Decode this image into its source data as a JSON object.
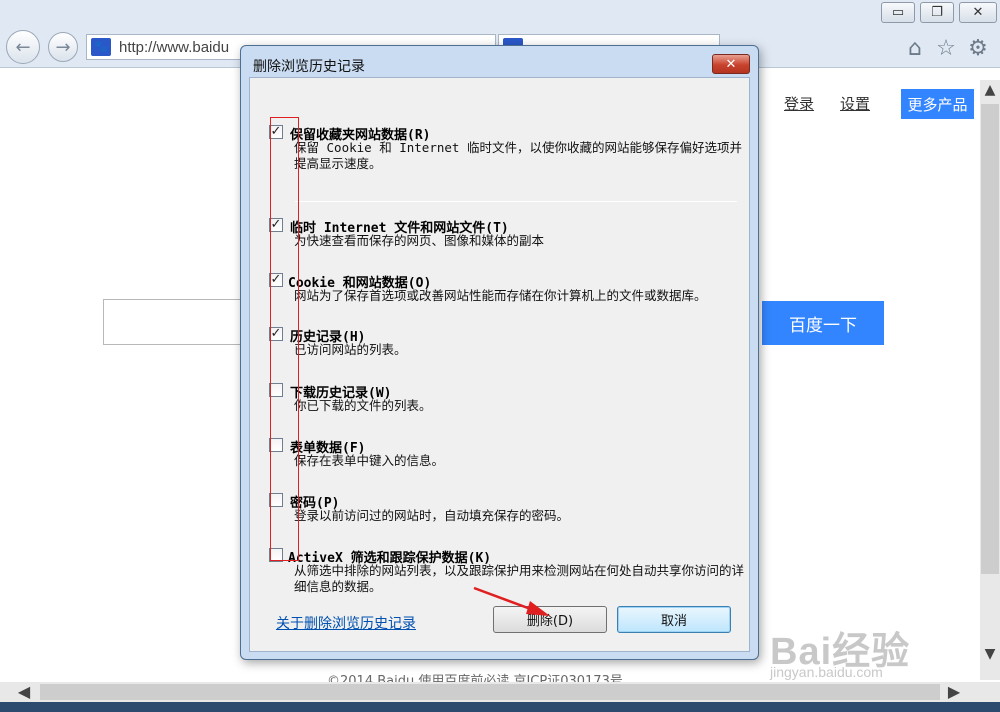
{
  "browser": {
    "url_text": "http://www.baidu",
    "window_controls": {
      "minimize": "▭",
      "restore": "❐",
      "close": "✕"
    },
    "back_glyph": "←",
    "forward_glyph": "→",
    "home_icon": "⌂",
    "favorites_icon": "☆",
    "settings_icon": "⚙"
  },
  "page": {
    "login_label": "登录",
    "settings_label": "设置",
    "more_products_label": "更多产品",
    "search_button_label": "百度一下",
    "footer_text": "©2014 Baidu 使用百度前必读 京ICP证030173号"
  },
  "dialog": {
    "title": "删除浏览历史记录",
    "close_glyph": "✕",
    "options": [
      {
        "title": "保留收藏夹网站数据(R)",
        "desc": "保留 Cookie 和 Internet 临时文件，以使你收藏的网站能够保存偏好选项并提高显示速度。",
        "checked": true
      },
      {
        "title": "临时 Internet 文件和网站文件(T)",
        "desc": "为快速查看而保存的网页、图像和媒体的副本",
        "checked": true
      },
      {
        "title": "Cookie 和网站数据(O)",
        "desc": "网站为了保存首选项或改善网站性能而存储在你计算机上的文件或数据库。",
        "checked": true
      },
      {
        "title": "历史记录(H)",
        "desc": "已访问网站的列表。",
        "checked": true
      },
      {
        "title": "下载历史记录(W)",
        "desc": "你已下载的文件的列表。",
        "checked": false
      },
      {
        "title": "表单数据(F)",
        "desc": "保存在表单中键入的信息。",
        "checked": false
      },
      {
        "title": "密码(P)",
        "desc": "登录以前访问过的网站时，自动填充保存的密码。",
        "checked": false
      },
      {
        "title": "ActiveX 筛选和跟踪保护数据(K)",
        "desc": "从筛选中排除的网站列表，以及跟踪保护用来检测网站在何处自动共享你访问的详细信息的数据。",
        "checked": false
      }
    ],
    "about_link": "关于删除浏览历史记录",
    "delete_button": "删除(D)",
    "cancel_button": "取消"
  },
  "watermark": {
    "brand": "Bai经验",
    "site": "jingyan.baidu.com"
  },
  "annotation_colors": {
    "red_box": "#e02020",
    "arrow": "#e02020"
  }
}
